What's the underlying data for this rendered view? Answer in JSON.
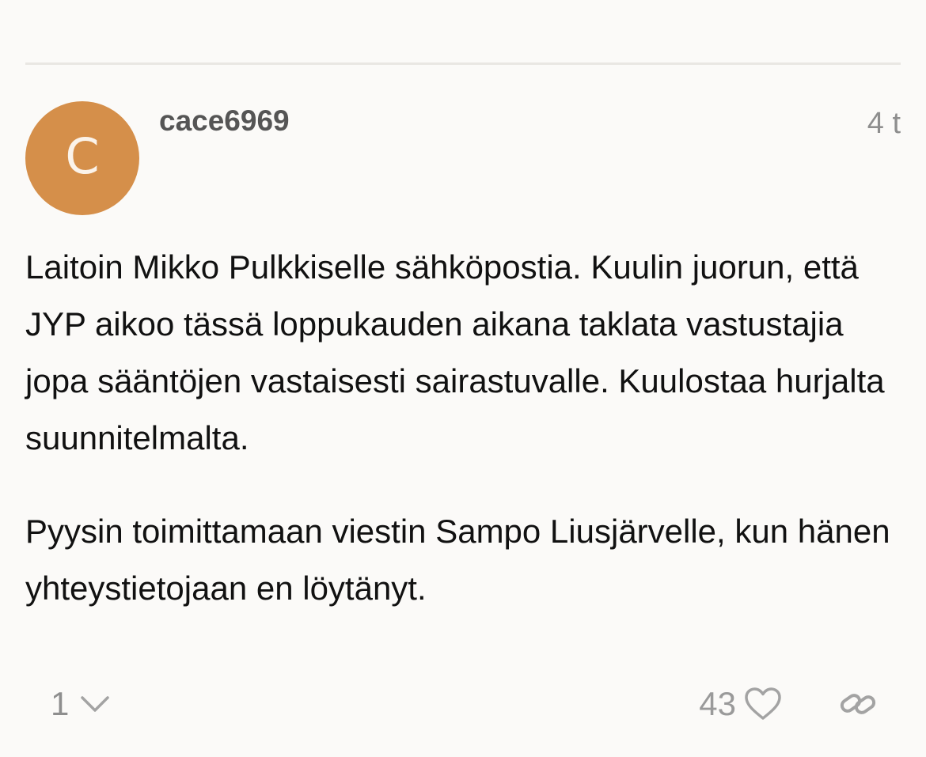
{
  "post": {
    "avatar_letter": "C",
    "username": "cace6969",
    "date": "4 t",
    "paragraphs": [
      "Laitoin Mikko Pulkkiselle sähköpostia. Kuulin juorun, että JYP aikoo tässä loppukauden aikana taklata vastustajia jopa sääntöjen vastaisesti sairastuvalle. Kuulostaa hurjalta suunnitelmalta.",
      "Pyysin toimittamaan viestin Sampo Liusjärvelle, kun hänen yhteystietojaan en löytänyt."
    ],
    "reply_count": "1",
    "like_count": "43"
  },
  "colors": {
    "avatar_bg": "#d58f4a",
    "background": "#fbfaf8",
    "muted_text": "#8e8e8e",
    "username": "#555555"
  },
  "icons": {
    "replies": "chevron-down-icon",
    "like": "heart-icon",
    "link": "link-icon"
  }
}
